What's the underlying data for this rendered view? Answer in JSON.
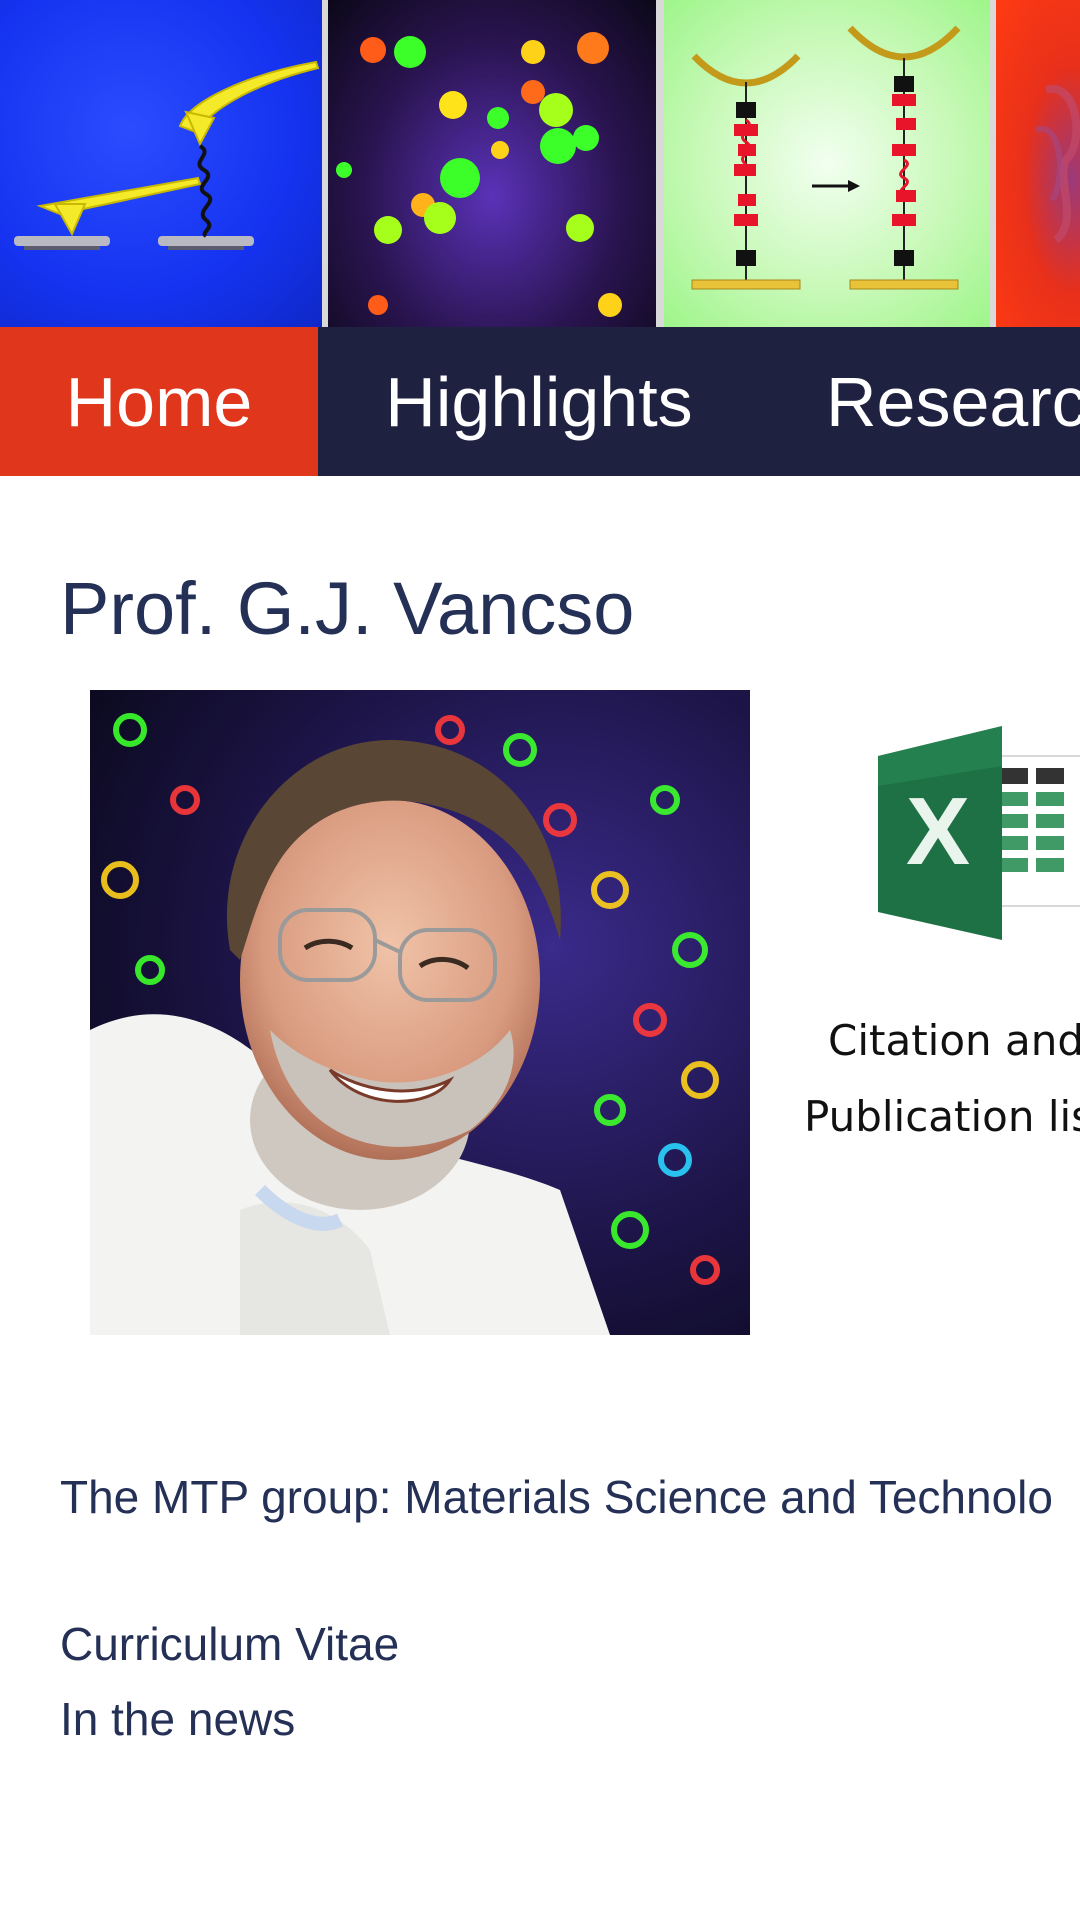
{
  "nav": {
    "items": [
      {
        "label": "Home",
        "active": true
      },
      {
        "label": "Highlights"
      },
      {
        "label": "Research"
      }
    ],
    "active_color": "#e0361c",
    "bar_color": "#1e2140"
  },
  "banner": {
    "images": [
      "afm-cantilever-illustration",
      "fluorescence-microscopy-particles",
      "afm-molecule-stretching-diagram",
      "orange-micrograph"
    ]
  },
  "main": {
    "title": "Prof. G.J. Vancso",
    "excel_icon": "excel-icon",
    "citation_link": "Citation and",
    "publication_link": "Publication lis",
    "mtp_text": "The MTP group: Materials Science and Technolo",
    "cv_link": "Curriculum Vitae",
    "news_link": "In the news"
  },
  "colors": {
    "title": "#243056",
    "text": "#111111"
  }
}
